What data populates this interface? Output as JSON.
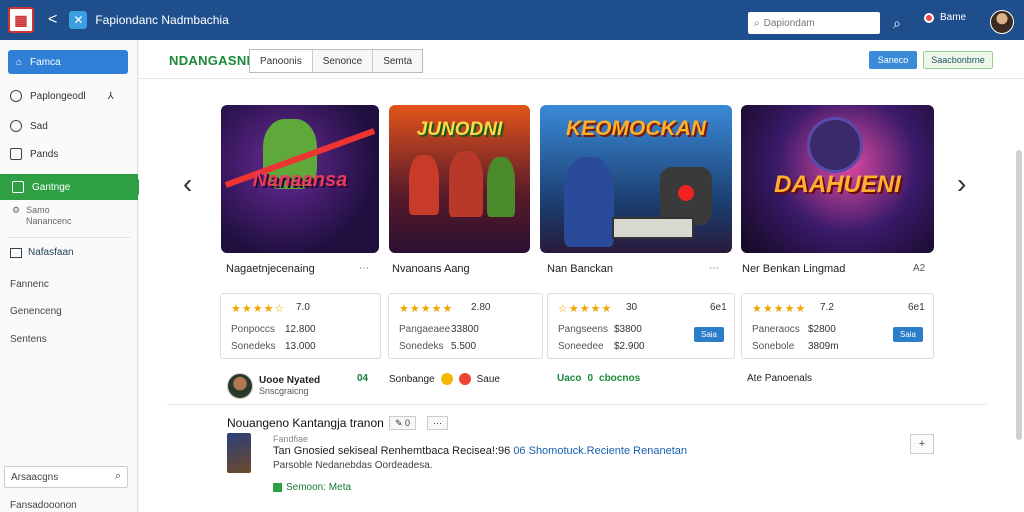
{
  "topbar": {
    "back_glyph": "<",
    "title": "Fapiondanc Nadmbachia",
    "search_placeholder": "Dapiondam",
    "notification_label": "Bame"
  },
  "sidebar": {
    "home_label": "Famca",
    "items": [
      {
        "label": "Paplongeodl",
        "icon": "clock-icon",
        "suffix": "⅄"
      },
      {
        "label": "Sad",
        "icon": "chat-icon"
      },
      {
        "label": "Pands",
        "icon": "grid-icon"
      }
    ],
    "active_label": "Gantnge",
    "sub_label_line1": "Samo",
    "sub_label_line2": "Nanancenc",
    "section_label": "Nafasfaan",
    "plain_items": [
      "Fannenc",
      "Genenceng",
      "Sentens"
    ],
    "search_label": "Arsaacgns",
    "footer_label": "Fansadooonon"
  },
  "main": {
    "brand": "NDANGASNI",
    "tabs": [
      "Panoonis",
      "Senonce",
      "Semta"
    ],
    "btn_primary": "Saneco",
    "btn_secondary": "Saacbonbrne",
    "arrow_left": "‹",
    "arrow_right": "›"
  },
  "cards": [
    {
      "art_title": "Nanaansa",
      "name": "Nagaetnjecenaing",
      "more": "⋯",
      "stars": "★★★★☆",
      "rating": "7.0",
      "label1": "Ponpoccs",
      "value1": "12.800",
      "label2": "Sonedeks",
      "value2": "13.000",
      "badge": ""
    },
    {
      "art_title": "JUNODNI",
      "name": "Nvanoans Aang",
      "more": "",
      "stars": "★★★★★",
      "rating": "2.80",
      "label1": "Pangaeaee",
      "value1": "33800",
      "label2": "Sonedeks",
      "value2": "5.500",
      "badge": ""
    },
    {
      "art_title": "KEOMOCKAN",
      "name": "Nan Banckan",
      "more": "⋯",
      "stars": "☆★★★★",
      "rating": "30",
      "label1": "Pangseens",
      "value1": "$3800",
      "label2": "Soneedee",
      "value2": "$2.900",
      "badge": "Saia"
    },
    {
      "art_title": "DAAHUENI",
      "name": "Ner Benkan Lingmad",
      "more": "A2",
      "stars": "★★★★★",
      "rating": "7.2",
      "label1": "Paneraocs",
      "value1": "$2800",
      "label2": "Sonebole",
      "value2": "3809m",
      "badge": "Saia"
    }
  ],
  "card_extras": {
    "card1_label": "",
    "card2_rating_suffix": "",
    "card3_rating_right": "6e1",
    "card4_rating_right": "6e1"
  },
  "social": {
    "user_name": "Uooe Nyated",
    "user_sub": "Snscgraicng",
    "count": "04",
    "reactions_label": "Sonbange",
    "reactions_suffix": "Saue",
    "uaco_label": "Uaco",
    "uaco_value": "0",
    "uaco_suffix": "cbocnos",
    "right_label": "Ate Panoenals"
  },
  "news": {
    "title": "Nouangeno Kantangja tranon",
    "chip1": "✎ 0",
    "chip2": "⋯",
    "meta": "Fandfiae",
    "line_text": "Tan Gnosied sekiseal Renhemtbaca Recisea!:96",
    "line_link": "06 Shomotuck.Reciente Renanetan",
    "sub_text": "Parsoble Nedanebdas Oordeadesa.",
    "tag_label": "Semoon: Meta",
    "plus": "+"
  },
  "colors": {
    "topbar": "#1f4e8c",
    "accent_blue": "#2f7fd6",
    "accent_green": "#2ea043",
    "star": "#f0a500"
  }
}
